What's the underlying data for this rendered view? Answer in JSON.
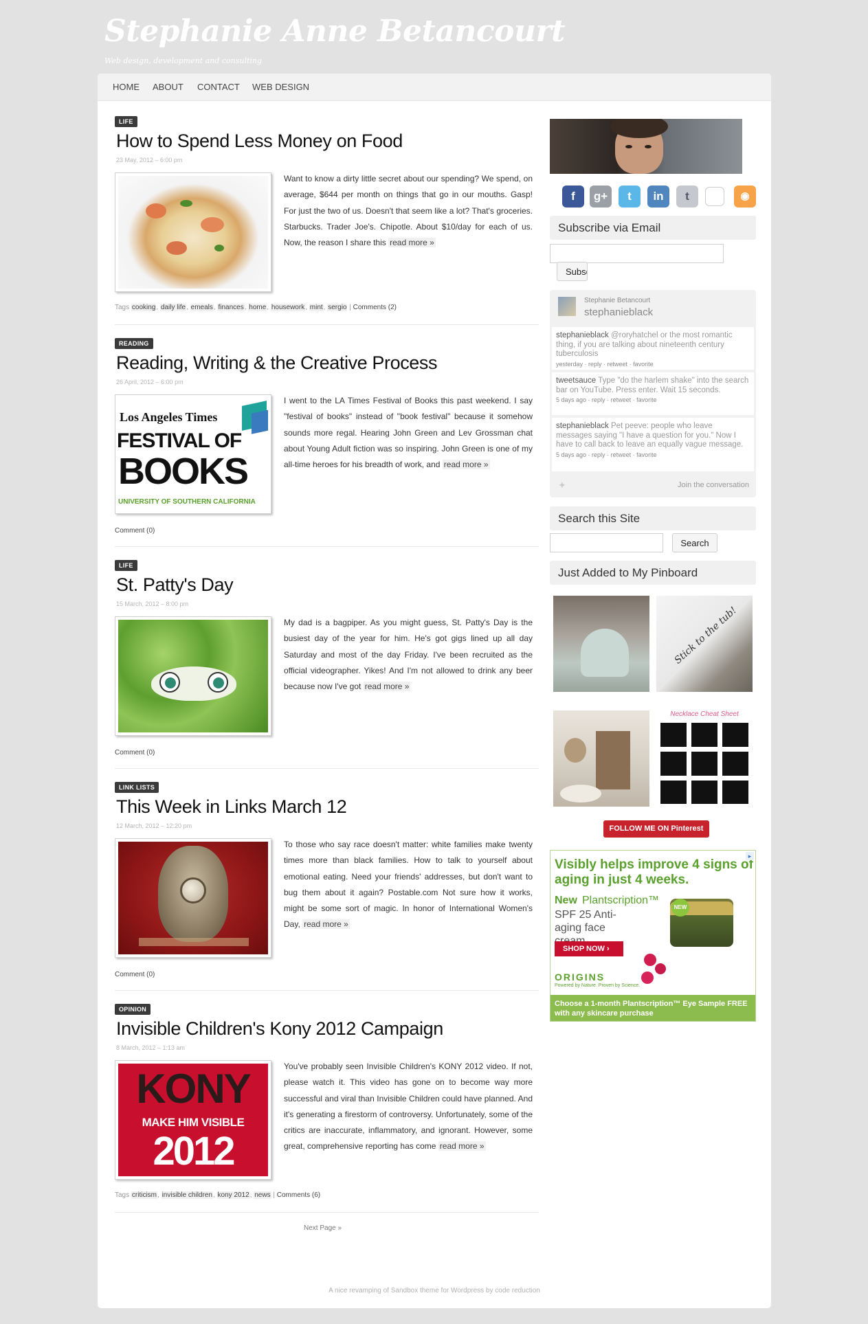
{
  "site": {
    "title": "Stephanie Anne Betancourt",
    "tagline": "Web design, development and consulting"
  },
  "nav": [
    "HOME",
    "ABOUT",
    "CONTACT",
    "WEB DESIGN"
  ],
  "posts": [
    {
      "category": "LIFE",
      "title": "How to Spend Less Money on Food",
      "date": "23 May, 2012 – 6:00 pm",
      "excerpt": "Want to know a dirty little secret about our spending? We spend, on average, $644 per month on things that go in our mouths. Gasp! For just the two of us. Doesn't that seem like a lot? That's groceries. Starbucks. Trader Joe's. Chipotle. About $10/day for each of us. Now, the reason I share this",
      "more": "read more »",
      "tags_label": "Tags",
      "tags": [
        "cooking",
        "daily life",
        "emeals",
        "finances",
        "home",
        "housework",
        "mint",
        "sergio"
      ],
      "comments": "Comments (2)"
    },
    {
      "category": "READING",
      "title": "Reading, Writing & the Creative Process",
      "date": "26 April, 2012 – 6:00 pm",
      "excerpt": "I went to the LA Times Festival of Books this past weekend. I say \"festival of books\" instead of \"book festival\" because it somehow sounds more regal. Hearing John Green and Lev Grossman chat about Young Adult fiction was so inspiring. John Green is one of my all-time heroes for his breadth of work, and",
      "more": "read more »",
      "comments": "Comment (0)",
      "image_text": {
        "line1": "Los Angeles Times",
        "line2": "FESTIVAL OF",
        "line3": "BOOKS",
        "line4": "UNIVERSITY OF SOUTHERN CALIFORNIA"
      }
    },
    {
      "category": "LIFE",
      "title": "St. Patty's Day",
      "date": "15 March, 2012 – 8:00 pm",
      "excerpt": "My dad is a bagpiper. As you might guess, St. Patty's Day is the busiest day of the year for him. He's got gigs lined up all day Saturday and most of the day Friday. I've been recruited as the official videographer. Yikes! And I'm not allowed to drink any beer because now I've got",
      "more": "read more »",
      "comments": "Comment (0)"
    },
    {
      "category": "LINK LISTS",
      "title": "This Week in Links March 12",
      "date": "12 March, 2012 – 12:20 pm",
      "excerpt": "To those who say race doesn't matter: white families make twenty times more than black families.  How to talk to yourself about emotional eating.  Need your friends' addresses, but don't want to bug them about it again? Postable.com  Not sure how it works, might be some sort of magic. In honor of International Women's Day,",
      "more": "read more »",
      "comments": "Comment (0)"
    },
    {
      "category": "OPINION",
      "title": "Invisible Children's Kony 2012 Campaign",
      "date": "8 March, 2012 – 1:13 am",
      "excerpt": "You've probably seen Invisible Children's KONY 2012 video. If not, please watch it.  This video has gone on to become way more successful and viral than Invisible Children could have planned.  And it's generating a firestorm of controversy. Unfortunately, some of the critics are inaccurate, inflammatory, and ignorant. However, some great, comprehensive reporting has come",
      "more": "read more »",
      "tags_label": "Tags",
      "tags": [
        "criticism",
        "invisible children",
        "kony 2012",
        "news"
      ],
      "comments": "Comments (6)",
      "image_text": {
        "line1": "KONY",
        "line2": "MAKE HIM VISIBLE",
        "line3": "2012"
      }
    }
  ],
  "pagination": {
    "next": "Next Page »"
  },
  "footer": {
    "credit": "A nice revamping of Sandbox theme for Wordpress by code reduction"
  },
  "sidebar": {
    "social_icons": [
      "facebook-icon",
      "google-plus-icon",
      "twitter-icon",
      "linkedin-icon",
      "tumblr-icon",
      "broken-image-icon",
      "rss-icon"
    ],
    "subscribe": {
      "title": "Subscribe via Email",
      "button": "Subscribe",
      "button_visible": "Subsc"
    },
    "twitter": {
      "name": "Stephanie Betancourt",
      "handle": "stephanieblack",
      "tweets": [
        {
          "user": "stephanieblack",
          "text": "@roryhatchel or the most romantic thing, if you are talking about nineteenth century tuberculosis",
          "time": "yesterday"
        },
        {
          "user": "tweetsauce",
          "text": "Type \"do the harlem shake\" into the search bar on YouTube. Press enter. Wait 15 seconds.",
          "time": "5 days ago"
        },
        {
          "user": "stephanieblack",
          "text": "Pet peeve: people who leave messages saying \"I have a question for you.\" Now I have to call back to leave an equally vague message.",
          "time": "5 days ago"
        }
      ],
      "actions": [
        "reply",
        "retweet",
        "favorite"
      ],
      "join": "Join the conversation"
    },
    "search": {
      "title": "Search this Site",
      "button": "Search"
    },
    "pinboard": {
      "title": "Just Added to My Pinboard",
      "follow_button": "FOLLOW ME ON Pinterest"
    },
    "ad": {
      "headline": "Visibly helps improve 4 signs of aging in just 4 weeks.",
      "product_new": "New",
      "product_name": "Plantscription™",
      "product_desc": "SPF 25 Anti-aging face cream",
      "cta": "SHOP NOW ›",
      "badge": "NEW",
      "brand": "ORIGINS",
      "brand_tagline": "Powered by Nature. Proven by Science.",
      "footer": "Choose a 1-month Plantscription™ Eye Sample FREE with any skincare purchase"
    }
  }
}
